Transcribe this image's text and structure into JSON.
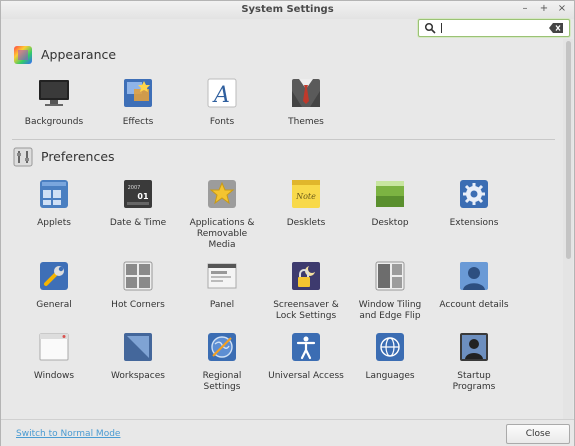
{
  "window": {
    "title": "System Settings",
    "controls": [
      "–",
      "+",
      "×"
    ]
  },
  "search": {
    "value": "",
    "placeholder": ""
  },
  "sections": {
    "appearance": {
      "title": "Appearance",
      "items": [
        {
          "label": "Backgrounds",
          "icon": "backgrounds-icon"
        },
        {
          "label": "Effects",
          "icon": "effects-icon"
        },
        {
          "label": "Fonts",
          "icon": "fonts-icon"
        },
        {
          "label": "Themes",
          "icon": "themes-icon"
        }
      ]
    },
    "preferences": {
      "title": "Preferences",
      "items": [
        {
          "label": "Applets",
          "icon": "applets-icon"
        },
        {
          "label": "Date & Time",
          "icon": "date-time-icon"
        },
        {
          "label": "Applications & Removable Media",
          "icon": "applications-media-icon"
        },
        {
          "label": "Desklets",
          "icon": "desklets-icon"
        },
        {
          "label": "Desktop",
          "icon": "desktop-icon"
        },
        {
          "label": "Extensions",
          "icon": "extensions-icon"
        },
        {
          "label": "General",
          "icon": "general-icon"
        },
        {
          "label": "Hot Corners",
          "icon": "hot-corners-icon"
        },
        {
          "label": "Panel",
          "icon": "panel-icon"
        },
        {
          "label": "Screensaver & Lock Settings",
          "icon": "screensaver-icon"
        },
        {
          "label": "Window Tiling and Edge Flip",
          "icon": "window-tiling-icon"
        },
        {
          "label": "Account details",
          "icon": "account-icon"
        },
        {
          "label": "Windows",
          "icon": "windows-icon"
        },
        {
          "label": "Workspaces",
          "icon": "workspaces-icon"
        },
        {
          "label": "Regional Settings",
          "icon": "regional-icon"
        },
        {
          "label": "Universal Access",
          "icon": "universal-access-icon"
        },
        {
          "label": "Languages",
          "icon": "languages-icon"
        },
        {
          "label": "Startup Programs",
          "icon": "startup-icon"
        }
      ]
    }
  },
  "calendar": {
    "year": "2007",
    "day": "01"
  },
  "footer": {
    "mode_link": "Switch to Normal Mode",
    "close_label": "Close"
  },
  "colors": {
    "link": "#4a9bd2",
    "search_border": "#9bc275",
    "accent_blue": "#4a7fc1"
  }
}
